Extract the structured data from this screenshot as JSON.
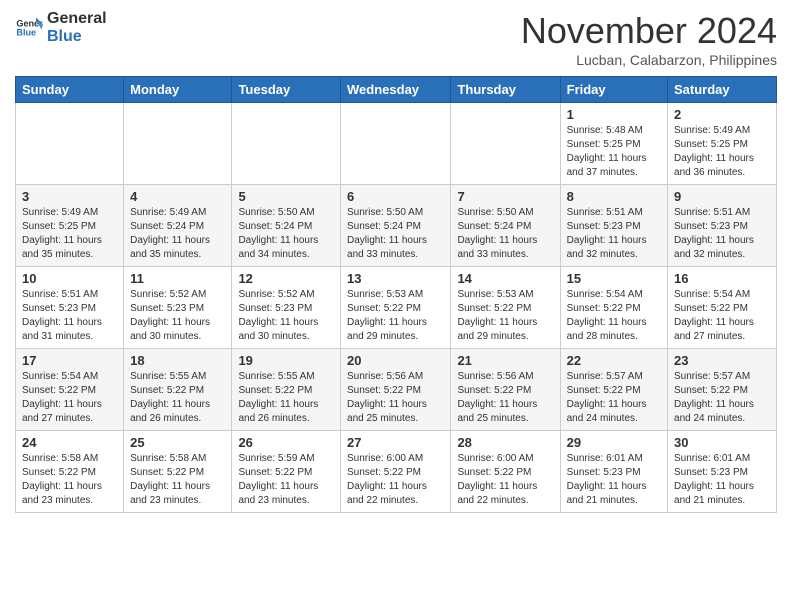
{
  "header": {
    "logo_general": "General",
    "logo_blue": "Blue",
    "month_title": "November 2024",
    "location": "Lucban, Calabarzon, Philippines"
  },
  "weekdays": [
    "Sunday",
    "Monday",
    "Tuesday",
    "Wednesday",
    "Thursday",
    "Friday",
    "Saturday"
  ],
  "weeks": [
    [
      {
        "day": "",
        "info": ""
      },
      {
        "day": "",
        "info": ""
      },
      {
        "day": "",
        "info": ""
      },
      {
        "day": "",
        "info": ""
      },
      {
        "day": "",
        "info": ""
      },
      {
        "day": "1",
        "info": "Sunrise: 5:48 AM\nSunset: 5:25 PM\nDaylight: 11 hours and 37 minutes."
      },
      {
        "day": "2",
        "info": "Sunrise: 5:49 AM\nSunset: 5:25 PM\nDaylight: 11 hours and 36 minutes."
      }
    ],
    [
      {
        "day": "3",
        "info": "Sunrise: 5:49 AM\nSunset: 5:25 PM\nDaylight: 11 hours and 35 minutes."
      },
      {
        "day": "4",
        "info": "Sunrise: 5:49 AM\nSunset: 5:24 PM\nDaylight: 11 hours and 35 minutes."
      },
      {
        "day": "5",
        "info": "Sunrise: 5:50 AM\nSunset: 5:24 PM\nDaylight: 11 hours and 34 minutes."
      },
      {
        "day": "6",
        "info": "Sunrise: 5:50 AM\nSunset: 5:24 PM\nDaylight: 11 hours and 33 minutes."
      },
      {
        "day": "7",
        "info": "Sunrise: 5:50 AM\nSunset: 5:24 PM\nDaylight: 11 hours and 33 minutes."
      },
      {
        "day": "8",
        "info": "Sunrise: 5:51 AM\nSunset: 5:23 PM\nDaylight: 11 hours and 32 minutes."
      },
      {
        "day": "9",
        "info": "Sunrise: 5:51 AM\nSunset: 5:23 PM\nDaylight: 11 hours and 32 minutes."
      }
    ],
    [
      {
        "day": "10",
        "info": "Sunrise: 5:51 AM\nSunset: 5:23 PM\nDaylight: 11 hours and 31 minutes."
      },
      {
        "day": "11",
        "info": "Sunrise: 5:52 AM\nSunset: 5:23 PM\nDaylight: 11 hours and 30 minutes."
      },
      {
        "day": "12",
        "info": "Sunrise: 5:52 AM\nSunset: 5:23 PM\nDaylight: 11 hours and 30 minutes."
      },
      {
        "day": "13",
        "info": "Sunrise: 5:53 AM\nSunset: 5:22 PM\nDaylight: 11 hours and 29 minutes."
      },
      {
        "day": "14",
        "info": "Sunrise: 5:53 AM\nSunset: 5:22 PM\nDaylight: 11 hours and 29 minutes."
      },
      {
        "day": "15",
        "info": "Sunrise: 5:54 AM\nSunset: 5:22 PM\nDaylight: 11 hours and 28 minutes."
      },
      {
        "day": "16",
        "info": "Sunrise: 5:54 AM\nSunset: 5:22 PM\nDaylight: 11 hours and 27 minutes."
      }
    ],
    [
      {
        "day": "17",
        "info": "Sunrise: 5:54 AM\nSunset: 5:22 PM\nDaylight: 11 hours and 27 minutes."
      },
      {
        "day": "18",
        "info": "Sunrise: 5:55 AM\nSunset: 5:22 PM\nDaylight: 11 hours and 26 minutes."
      },
      {
        "day": "19",
        "info": "Sunrise: 5:55 AM\nSunset: 5:22 PM\nDaylight: 11 hours and 26 minutes."
      },
      {
        "day": "20",
        "info": "Sunrise: 5:56 AM\nSunset: 5:22 PM\nDaylight: 11 hours and 25 minutes."
      },
      {
        "day": "21",
        "info": "Sunrise: 5:56 AM\nSunset: 5:22 PM\nDaylight: 11 hours and 25 minutes."
      },
      {
        "day": "22",
        "info": "Sunrise: 5:57 AM\nSunset: 5:22 PM\nDaylight: 11 hours and 24 minutes."
      },
      {
        "day": "23",
        "info": "Sunrise: 5:57 AM\nSunset: 5:22 PM\nDaylight: 11 hours and 24 minutes."
      }
    ],
    [
      {
        "day": "24",
        "info": "Sunrise: 5:58 AM\nSunset: 5:22 PM\nDaylight: 11 hours and 23 minutes."
      },
      {
        "day": "25",
        "info": "Sunrise: 5:58 AM\nSunset: 5:22 PM\nDaylight: 11 hours and 23 minutes."
      },
      {
        "day": "26",
        "info": "Sunrise: 5:59 AM\nSunset: 5:22 PM\nDaylight: 11 hours and 23 minutes."
      },
      {
        "day": "27",
        "info": "Sunrise: 6:00 AM\nSunset: 5:22 PM\nDaylight: 11 hours and 22 minutes."
      },
      {
        "day": "28",
        "info": "Sunrise: 6:00 AM\nSunset: 5:22 PM\nDaylight: 11 hours and 22 minutes."
      },
      {
        "day": "29",
        "info": "Sunrise: 6:01 AM\nSunset: 5:23 PM\nDaylight: 11 hours and 21 minutes."
      },
      {
        "day": "30",
        "info": "Sunrise: 6:01 AM\nSunset: 5:23 PM\nDaylight: 11 hours and 21 minutes."
      }
    ]
  ]
}
